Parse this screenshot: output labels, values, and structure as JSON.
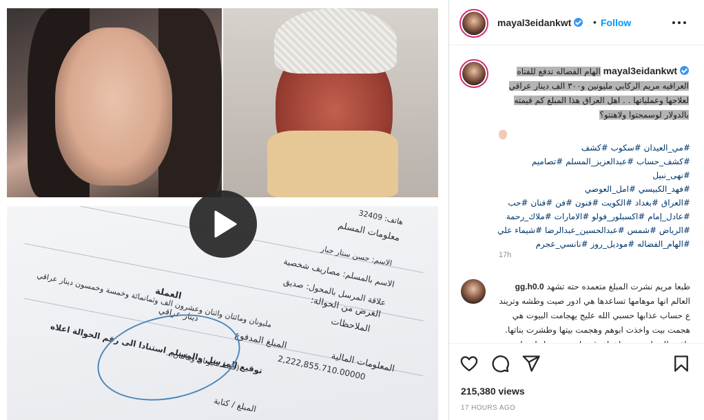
{
  "post": {
    "username": "mayal3eidankwt",
    "follow_label": "Follow",
    "separator": "•",
    "more_icon": "more-dots-icon",
    "play_icon": "play-icon"
  },
  "media": {
    "doc_lines": [
      "معلومات المسلم",
      "الاسم: حسن ستار جبار",
      "هاتف: 32409",
      "الاسم بالمسلم: مصاريف شخصية",
      "علاقة المرسل بالمحول: صديق",
      "الغرض من الحوالة:",
      "الملاحظات",
      "العملة",
      "المعلومات المالية",
      "المبلغ المدفوع",
      "دينار عراقي",
      "2,222,855.710.00000",
      "مليونان ومائتان واثنان وعشرون الف وثمانمائة وخمسة وخمسون دينار عراقي",
      "(فقط مليونان ومائتان...",
      "توقيع المرسل والمسلم استنادا الى رقم الحوالة اعلاه",
      "المبلغ / كتابة"
    ]
  },
  "caption": {
    "username": "mayal3eidankwt",
    "lines": [
      "الهام الفضاله تدفع للفتاه",
      "العراقيه مريم الركابي مليونين و٣٠٠ الف دينار عراقي",
      "لعلاجها وعملياتها . . اهل العراق هذا المبلغ كم قيمته",
      "بالدولار لوسمحتوا ولاهنتو؟"
    ],
    "hashtag_lines": [
      "#مي_العيدان #سكوب #كشف",
      "#كشف_حساب #عبدالعزيز_المسلم #تصاميم #نهى_نبيل",
      "#فهد_الكبيسي #امل_العوضي",
      "#العراق #بغداد #الكويت #فنون #فن #فنان #حب",
      "#عادل_إمام #اكسبلور_فولو #الامارات #ملاك_رحمة",
      "#الرياض #شمس #عبدالحسين_عبدالرضا #شيماء علي",
      "#الهام_الفضاله #موديل_روز #نانسي_عجرم"
    ],
    "age": "17h"
  },
  "comment": {
    "username": "0.gg.h0",
    "lines": [
      "طبعا مريم نشرت المبلغ متعمده حته تشهد",
      "العالم انها موهامها تساعدها هي ادور صيت وطشه وتريند",
      "ع حساب عذابها حسبي الله عليج يهجامت البيوت هي",
      "هجمت بيت واخذت ابوهم وهجمت بيتها وطشرت بناتها.",
      "داعت العيدان مني ماخطيه قبرها وتعمت بناتها حرام تموهها"
    ]
  },
  "actions": {
    "like_icon": "heart-icon",
    "comment_icon": "comment-icon",
    "share_icon": "share-icon",
    "save_icon": "bookmark-icon",
    "views": "215,380 views",
    "date": "17 HOURS AGO"
  },
  "colors": {
    "follow": "#0095f6",
    "verified": "#3897f0",
    "hashtag": "#00376b",
    "selection": "#b4b4b4"
  }
}
